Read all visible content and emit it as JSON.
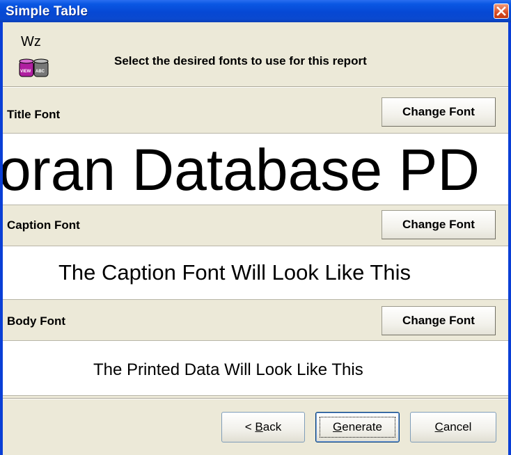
{
  "window": {
    "title": "Simple Table"
  },
  "header": {
    "instruction": "Select the desired fonts to use for this report",
    "icon_text_top": "Wz",
    "icon_badge_left": "VIEW",
    "icon_badge_right": "ABC"
  },
  "sections": [
    {
      "label": "Title Font",
      "button_label": "Change Font",
      "preview_text": "oran Database PD"
    },
    {
      "label": "Caption Font",
      "button_label": "Change Font",
      "preview_text": "The Caption Font Will Look Like This"
    },
    {
      "label": "Body Font",
      "button_label": "Change Font",
      "preview_text": "The Printed Data Will Look Like This"
    }
  ],
  "footer": {
    "back": {
      "prefix": "< ",
      "mnemonic": "B",
      "rest": "ack"
    },
    "generate": {
      "mnemonic": "G",
      "rest": "enerate"
    },
    "cancel": {
      "mnemonic": "C",
      "rest": "ancel"
    }
  },
  "colors": {
    "titlebar": "#0a57e3",
    "dialog_bg": "#ece9d8",
    "preview_bg": "#ffffff",
    "close_button": "#d94c24"
  },
  "icons": {
    "close": "close-icon",
    "wizard": "wizard-icon"
  }
}
